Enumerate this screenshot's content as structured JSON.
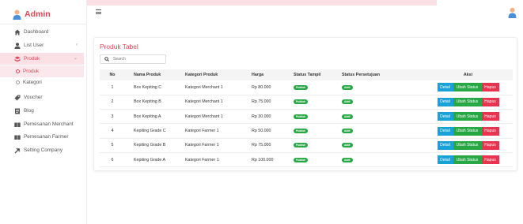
{
  "brand": {
    "title": "Admin"
  },
  "sidebar": {
    "items": [
      {
        "label": "Dashboard",
        "icon": "home-icon"
      },
      {
        "label": "List User",
        "icon": "user-icon",
        "chevron": "‹"
      },
      {
        "label": "Produk",
        "icon": "layers-icon",
        "chevron": "⌄"
      },
      {
        "label": "Produk",
        "icon": "circle-icon"
      },
      {
        "label": "Kategori",
        "icon": "circle-icon"
      },
      {
        "label": "Voucher",
        "icon": "tag-icon"
      },
      {
        "label": "Blog",
        "icon": "document-icon"
      },
      {
        "label": "Pemesanan Merchant",
        "icon": "book-icon"
      },
      {
        "label": "Pemesanan Farmer",
        "icon": "book-icon"
      },
      {
        "label": "Setting Company",
        "icon": "tools-icon"
      }
    ]
  },
  "main": {
    "title": "Produk Tabel",
    "search": {
      "placeholder": "Search",
      "value": ""
    },
    "table": {
      "headers": [
        "No",
        "Nama Produk",
        "Kategori Produk",
        "Harga",
        "Status Tampil",
        "Status Persetujuan",
        "Aksi"
      ],
      "rows": [
        {
          "no": "1",
          "nama": "Box Kepiting C",
          "kategori": "Kategori Merchant 1",
          "harga": "Rp 80.000",
          "tampil": "Publish",
          "setuju": "Aktif"
        },
        {
          "no": "2",
          "nama": "Box Kepiting B",
          "kategori": "Kategori Merchant 1",
          "harga": "Rp 75.000",
          "tampil": "Publish",
          "setuju": "Aktif"
        },
        {
          "no": "3",
          "nama": "Box Kepiting A",
          "kategori": "Kategori Merchant 1",
          "harga": "Rp 30.000",
          "tampil": "Publish",
          "setuju": "Aktif"
        },
        {
          "no": "4",
          "nama": "Kepiting Grade C",
          "kategori": "Kategori Farmer 1",
          "harga": "Rp 50.000",
          "tampil": "Publish",
          "setuju": "Aktif"
        },
        {
          "no": "5",
          "nama": "Kepiting Grade B",
          "kategori": "Kategori Farmer 1",
          "harga": "Rp 75.000",
          "tampil": "Publish",
          "setuju": "Aktif"
        },
        {
          "no": "6",
          "nama": "Kepiting Grade A",
          "kategori": "Kategori Farmer 1",
          "harga": "Rp 100.000",
          "tampil": "Publish",
          "setuju": "Aktif"
        }
      ],
      "actions": {
        "detail": "Detail",
        "ubah": "Ubah Status",
        "hapus": "Hapus"
      }
    }
  },
  "colors": {
    "accent": "#e04656",
    "pink_bg": "#fbe0e5",
    "detail": "#17a2d8",
    "success": "#28a745",
    "danger": "#e8344e"
  }
}
